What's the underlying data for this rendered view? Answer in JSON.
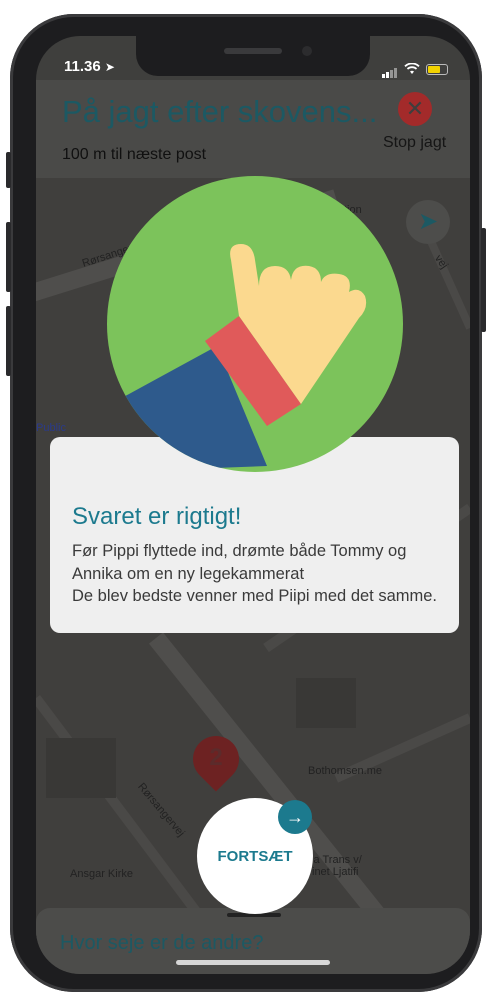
{
  "status_bar": {
    "time": "11.36"
  },
  "header": {
    "title": "På jagt efter skovens...",
    "distance": "100 m til næste post",
    "stop_label": "Stop jagt",
    "stop_icon": "close-icon"
  },
  "map": {
    "street_labels": [
      "Rørsangervej",
      "Rørsangervej"
    ],
    "poi_labels": [
      "Bothomsen.me",
      "Ansgar Kirke",
      "Public",
      "tion",
      "vej",
      "sa Trans v/",
      "inet Ljatifi"
    ],
    "marker_number": "2"
  },
  "result": {
    "title": "Svaret er rigtigt!",
    "body": "Før Pippi flyttede ind, drømte både Tommy og Annika om en ny legekammerat\nDe blev bedste venner med Piipi med det samme."
  },
  "continue_button": {
    "label": "FORTSÆT",
    "icon": "arrow-right-icon"
  },
  "bottom_sheet": {
    "title": "Hvor seje er de andre?"
  },
  "colors": {
    "accent": "#1c7a8e",
    "badge_green": "#7cc35b",
    "stop_red": "#a32a2a"
  }
}
